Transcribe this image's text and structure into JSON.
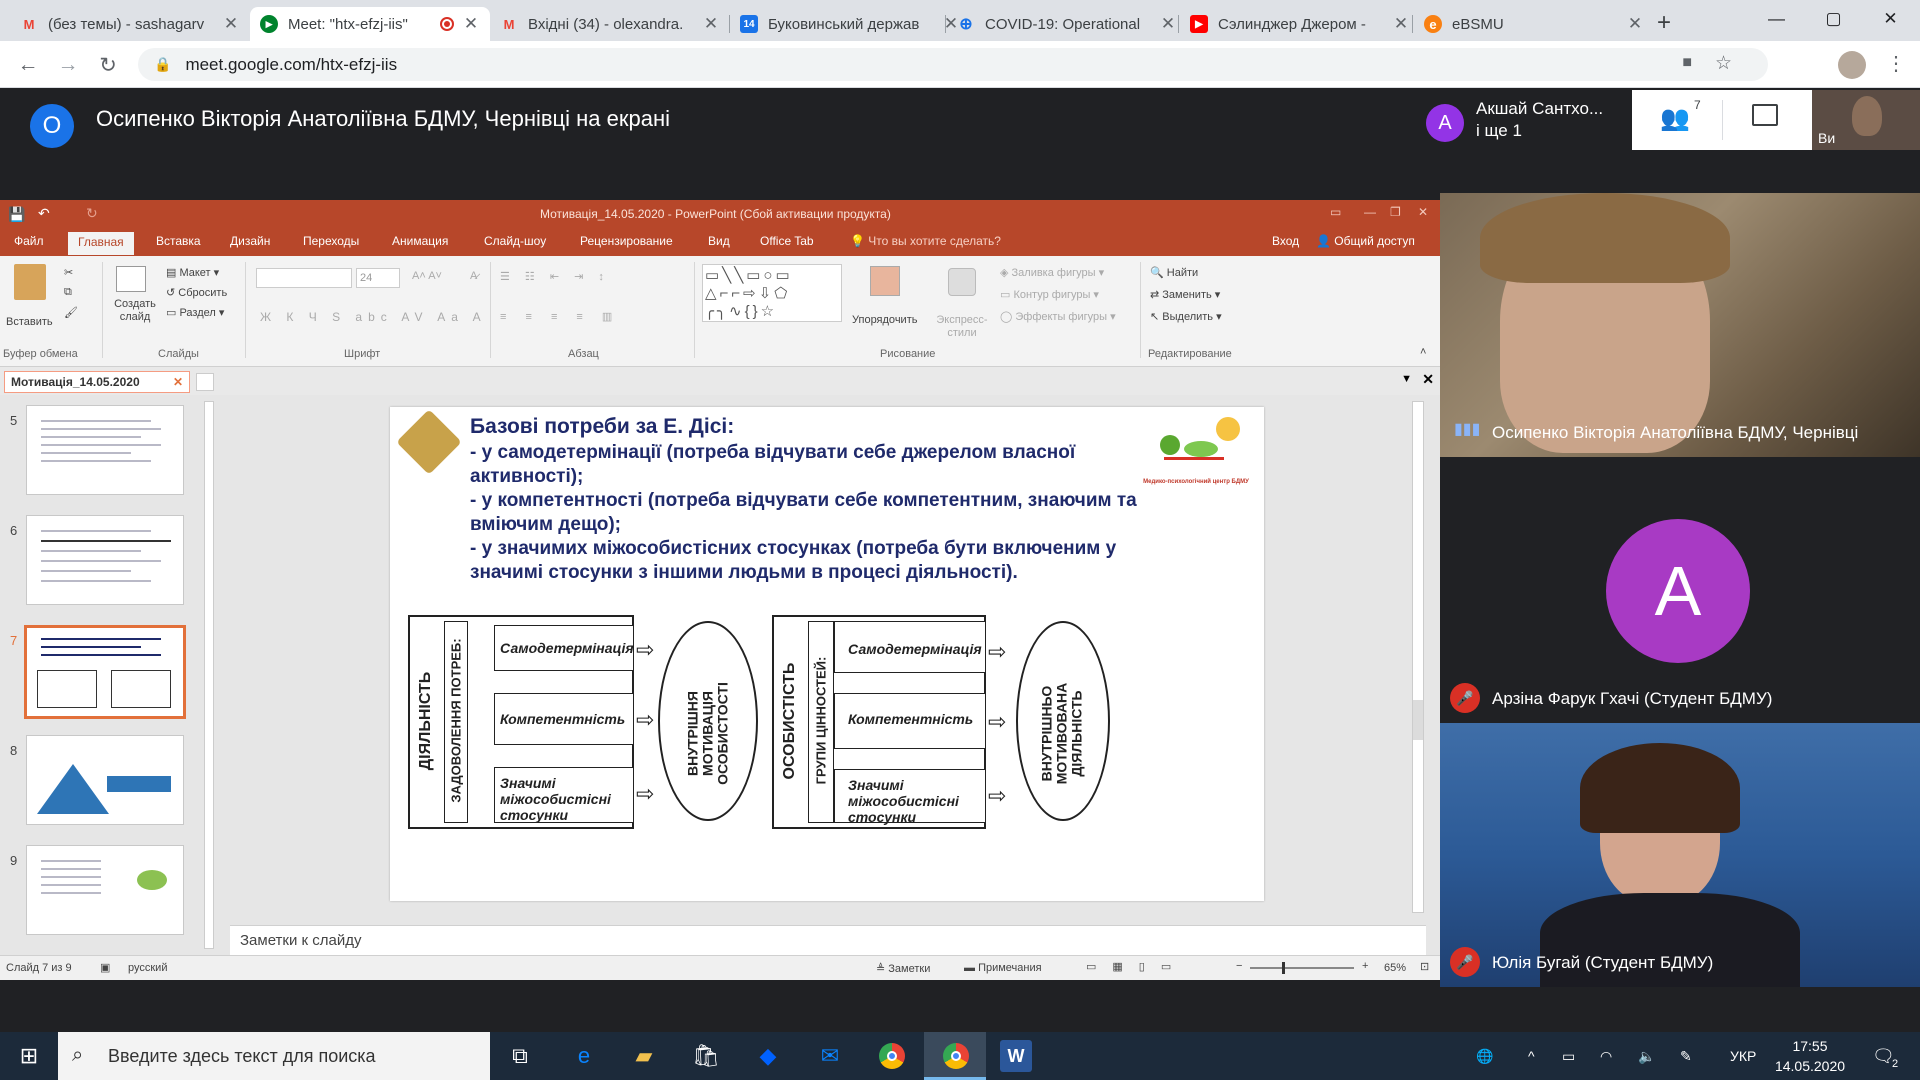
{
  "browser": {
    "tabs": [
      {
        "title": "(без темы) - sashagarv",
        "favicon": "gmail-icon",
        "active": false
      },
      {
        "title": "Meet: \"htx-efzj-iis\"",
        "favicon": "meet-icon",
        "active": true
      },
      {
        "title": "Вхідні (34) - olexandra.",
        "favicon": "gmail-icon",
        "active": false
      },
      {
        "title": "Буковинський держав",
        "favicon": "calendar-icon",
        "active": false
      },
      {
        "title": "COVID-19: Operational",
        "favicon": "who-icon",
        "active": false
      },
      {
        "title": "Сэлинджер Джером -",
        "favicon": "youtube-icon",
        "active": false
      },
      {
        "title": "eBSMU",
        "favicon": "moodle-icon",
        "active": false
      }
    ],
    "tab4_badge": "14",
    "new_tab": "+",
    "url": "meet.google.com/htx-efzj-iis",
    "window_controls": {
      "minimize": "—",
      "maximize": "▢",
      "close": "✕"
    }
  },
  "meet": {
    "presenter_initial": "О",
    "presenting_title": "Осипенко Вікторія Анатоліївна БДМУ, Чернівці на екрані",
    "participant_chip": {
      "initial": "А",
      "name": "Акшай Сантхо...",
      "more": "і ще 1"
    },
    "people_count": "7",
    "self_label": "Ви",
    "tiles": [
      {
        "name": "Осипенко Вікторія Анатоліївна БДМУ, Чернівці",
        "muted": false
      },
      {
        "name": "Арзіна Фарук Гхачі (Студент БДМУ)",
        "initial": "А",
        "muted": true,
        "avatar_color": "#a83ac4"
      },
      {
        "name": "Юлія Бугай (Студент БДМУ)",
        "muted": true
      }
    ]
  },
  "powerpoint": {
    "title": "Мотивація_14.05.2020 - PowerPoint (Сбой активации продукта)",
    "ribbon_tabs": [
      "Файл",
      "Главная",
      "Вставка",
      "Дизайн",
      "Переходы",
      "Анимация",
      "Слайд-шоу",
      "Рецензирование",
      "Вид",
      "Office Tab"
    ],
    "active_tab": "Главная",
    "tell_me": "Что вы хотите сделать?",
    "sign_in": "Вход",
    "share": "Общий доступ",
    "groups": {
      "clipboard": "Буфер обмена",
      "slides": "Слайды",
      "font": "Шрифт",
      "paragraph": "Абзац",
      "drawing": "Рисование",
      "editing": "Редактирование"
    },
    "buttons": {
      "paste": "Вставить",
      "new_slide": "Создать слайд",
      "layout": "Макет",
      "reset": "Сбросить",
      "section": "Раздел",
      "font_size": "24",
      "arrange": "Упорядочить",
      "quick_styles": "Экспресс-стили",
      "shape_fill": "Заливка фигуры",
      "shape_outline": "Контур фигуры",
      "shape_effects": "Эффекты фигуры",
      "find": "Найти",
      "replace": "Заменить",
      "select": "Выделить"
    },
    "doc_tab": "Мотивація_14.05.2020",
    "thumbnail_numbers": [
      "5",
      "6",
      "7",
      "8",
      "9"
    ],
    "selected_slide": "7",
    "notes_placeholder": "Заметки к слайду",
    "status": {
      "slide_of": "Слайд 7 из 9",
      "language": "русский",
      "notes": "Заметки",
      "comments": "Примечания",
      "zoom": "65%"
    }
  },
  "slide": {
    "heading": "Базові потреби за Е. Дісі:",
    "lines": [
      "- у самодетермінації (потреба відчувати себе джерелом власної",
      "активності);",
      "- у компетентності (потреба відчувати себе компетентним, знаючим та",
      "вміючим дещо);",
      "- у значимих міжособистісних стосунках (потреба бути включеним у",
      "значимі стосунки з іншими людьми в процесі діяльності)."
    ],
    "logo_caption": "Медико-психологічний центр БДМУ",
    "left_diagram": {
      "outer": "ДІЯЛЬНІСТЬ",
      "inner": "ЗАДОВОЛЕННЯ ПОТРЕБ:",
      "items": [
        "Самодетермінація",
        "Компетентність",
        "Значимі міжособистісні стосунки"
      ],
      "result": "ВНУТРІШНЯ МОТИВАЦІЯ ОСОБИСТОСТІ"
    },
    "right_diagram": {
      "outer": "ОСОБИСТІСТЬ",
      "inner": "ГРУПИ ЦІННОСТЕЙ:",
      "items": [
        "Самодетермінація",
        "Компетентність",
        "Значимі міжособистісні стосунки"
      ],
      "result": "ВНУТРІШНЬО МОТИВОВАНА ДІЯЛЬНІСТЬ"
    }
  },
  "taskbar": {
    "search_placeholder": "Введите здесь текст для поиска",
    "language": "УКР",
    "time": "17:55",
    "date": "14.05.2020",
    "notification_count": "2"
  }
}
